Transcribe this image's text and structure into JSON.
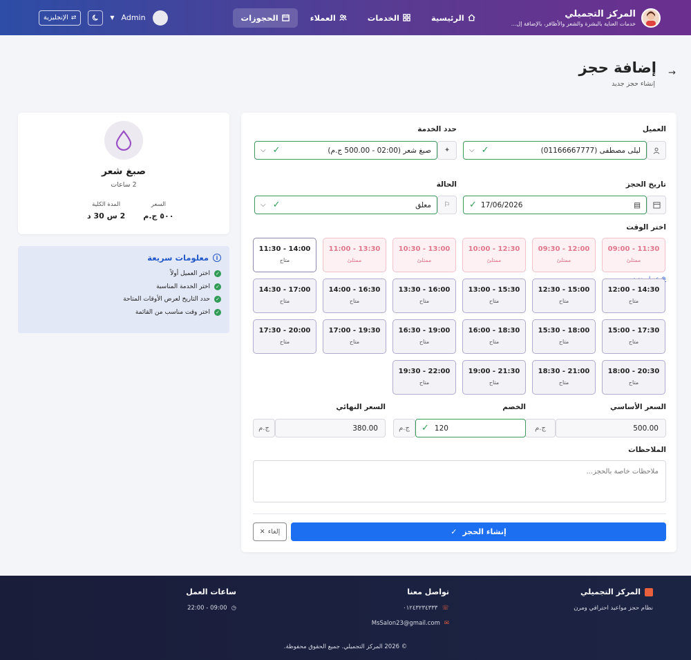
{
  "header": {
    "brand_title": "المركز التجميلي",
    "brand_sub": "خدمات العناية بالبشرة والشعر والأظافر، بالإضافة إل...",
    "nav": [
      {
        "label": "الرئيسية",
        "icon": "home-icon"
      },
      {
        "label": "الخدمات",
        "icon": "grid-icon"
      },
      {
        "label": "العملاء",
        "icon": "users-icon"
      },
      {
        "label": "الحجوزات",
        "icon": "calendar-icon",
        "active": true
      }
    ],
    "user": "Admin",
    "lang": "الإنجليزية"
  },
  "page": {
    "title": "إضافة حجز",
    "subtitle": "إنشاء حجز جديد"
  },
  "form": {
    "client_label": "العميل",
    "client_value": "ليلى مصطفى (01166667777)",
    "new_client": "عميل جديد",
    "service_label": "حدد الخدمة",
    "service_value": "صبغ شعر (02:00 - 500.00 ج.م)",
    "date_label": "تاريخ الحجز",
    "date_value": "17/06/2026",
    "status_label": "الحالة",
    "status_value": "معلق",
    "time_label": "اختر الوقت",
    "slots": [
      {
        "time": "09:00 - 11:30",
        "status": "ممتلئ",
        "busy": true
      },
      {
        "time": "09:30 - 12:00",
        "status": "ممتلئ",
        "busy": true
      },
      {
        "time": "10:00 - 12:30",
        "status": "ممتلئ",
        "busy": true
      },
      {
        "time": "10:30 - 13:00",
        "status": "ممتلئ",
        "busy": true
      },
      {
        "time": "11:00 - 13:30",
        "status": "ممتلئ",
        "busy": true
      },
      {
        "time": "11:30 - 14:00",
        "status": "متاح",
        "busy": false
      },
      {
        "time": "12:00 - 14:30",
        "status": "متاح",
        "busy": false
      },
      {
        "time": "12:30 - 15:00",
        "status": "متاح",
        "busy": false
      },
      {
        "time": "13:00 - 15:30",
        "status": "متاح",
        "busy": false
      },
      {
        "time": "13:30 - 16:00",
        "status": "متاح",
        "busy": false
      },
      {
        "time": "14:00 - 16:30",
        "status": "متاح",
        "busy": false
      },
      {
        "time": "14:30 - 17:00",
        "status": "متاح",
        "busy": false
      },
      {
        "time": "15:00 - 17:30",
        "status": "متاح",
        "busy": false
      },
      {
        "time": "15:30 - 18:00",
        "status": "متاح",
        "busy": false
      },
      {
        "time": "16:00 - 18:30",
        "status": "متاح",
        "busy": false
      },
      {
        "time": "16:30 - 19:00",
        "status": "متاح",
        "busy": false
      },
      {
        "time": "17:00 - 19:30",
        "status": "متاح",
        "busy": false
      },
      {
        "time": "17:30 - 20:00",
        "status": "متاح",
        "busy": false
      },
      {
        "time": "18:00 - 20:30",
        "status": "متاح",
        "busy": false
      },
      {
        "time": "18:30 - 21:00",
        "status": "متاح",
        "busy": false
      },
      {
        "time": "19:00 - 21:30",
        "status": "متاح",
        "busy": false
      },
      {
        "time": "19:30 - 22:00",
        "status": "متاح",
        "busy": false
      }
    ],
    "base_price_label": "السعر الأساسي",
    "base_price": "500.00",
    "discount_label": "الخصم",
    "discount": "120",
    "final_price_label": "السعر النهائي",
    "final_price": "380.00",
    "currency": "ج.م",
    "notes_label": "الملاحظات",
    "notes_placeholder": "ملاحظات خاصة بالحجز...",
    "submit": "إنشاء الحجز",
    "cancel": "إلغاء"
  },
  "service_card": {
    "name": "صبغ شعر",
    "duration": "2 ساعات",
    "price_label": "السعر",
    "price": "٥٠٠ ج.م",
    "total_label": "المدة الكلية",
    "total": "2 س 30 د"
  },
  "quick_info": {
    "title": "معلومات سريعة",
    "items": [
      "اختر العميل أولاً",
      "اختر الخدمة المناسبة",
      "حدد التاريخ لعرض الأوقات المتاحة",
      "اختر وقت مناسب من القائمة"
    ]
  },
  "footer": {
    "brand": "المركز التجميلي",
    "brand_sub": "نظام حجز مواعيد احترافي ومرن",
    "contact_title": "تواصل معنا",
    "phone": "٠١٢٤٣٢٣٤٣٣٣",
    "email": "MsSalon23@gmail.com",
    "hours_title": "ساعات العمل",
    "hours": "09:00 - 22:00",
    "copyright": "© 2026 المركز التجميلي. جميع الحقوق محفوظة."
  },
  "colors": {
    "accent": "#1d6ff2",
    "success": "#2f9b55",
    "busy": "#e0768c"
  }
}
